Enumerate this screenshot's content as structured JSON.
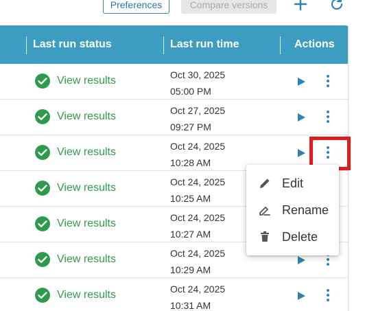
{
  "toolbar": {
    "preferences_label": "Preferences",
    "compare_label": "Compare versions",
    "add_icon": "plus-icon",
    "refresh_icon": "refresh-icon"
  },
  "table": {
    "headers": {
      "status": "Last run status",
      "time": "Last run time",
      "actions": "Actions"
    },
    "rows": [
      {
        "status": "View results",
        "date": "Oct 30, 2025",
        "time": "05:00 PM"
      },
      {
        "status": "View results",
        "date": "Oct 27, 2025",
        "time": "09:27 PM"
      },
      {
        "status": "View results",
        "date": "Oct 24, 2025",
        "time": "10:28 AM"
      },
      {
        "status": "View results",
        "date": "Oct 24, 2025",
        "time": "10:25 AM"
      },
      {
        "status": "View results",
        "date": "Oct 24, 2025",
        "time": "10:27 AM"
      },
      {
        "status": "View results",
        "date": "Oct 24, 2025",
        "time": "10:29 AM"
      },
      {
        "status": "View results",
        "date": "Oct 24, 2025",
        "time": "10:31 AM"
      }
    ]
  },
  "context_menu": {
    "items": [
      {
        "label": "Edit",
        "icon": "pencil-icon"
      },
      {
        "label": "Rename",
        "icon": "rename-icon"
      },
      {
        "label": "Delete",
        "icon": "trash-icon"
      }
    ]
  },
  "colors": {
    "header_bg": "#3d9dc0",
    "success": "#2e9a4b",
    "action_blue": "#2a86b0",
    "highlight": "#e01b1b"
  }
}
